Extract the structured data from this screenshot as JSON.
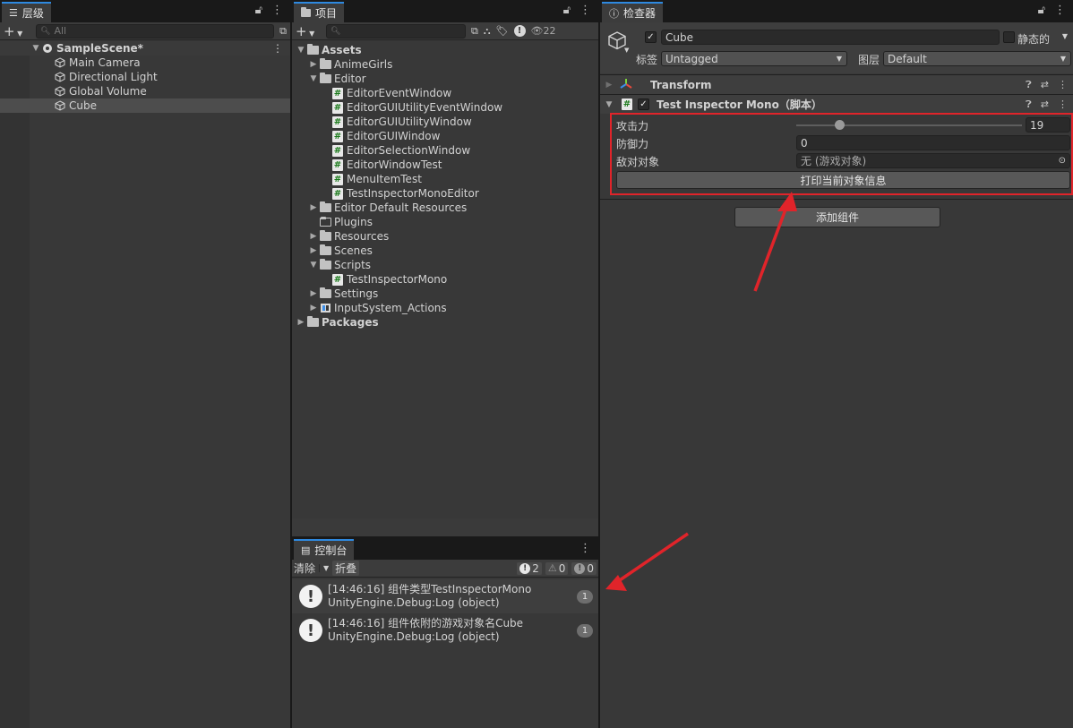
{
  "hierarchy": {
    "tab_label": "层级",
    "search_placeholder": "All",
    "scene": "SampleScene*",
    "items": [
      "Main Camera",
      "Directional Light",
      "Global Volume",
      "Cube"
    ],
    "selected": "Cube"
  },
  "project": {
    "tab_label": "项目",
    "hidden_count": "22",
    "tree": [
      {
        "label": "Assets",
        "depth": 0,
        "type": "folder-open",
        "expanded": true,
        "bold": true
      },
      {
        "label": "AnimeGirls",
        "depth": 1,
        "type": "folder",
        "expanded": false
      },
      {
        "label": "Editor",
        "depth": 1,
        "type": "folder-open",
        "expanded": true
      },
      {
        "label": "EditorEventWindow",
        "depth": 2,
        "type": "script"
      },
      {
        "label": "EditorGUIUtilityEventWindow",
        "depth": 2,
        "type": "script"
      },
      {
        "label": "EditorGUIUtilityWindow",
        "depth": 2,
        "type": "script"
      },
      {
        "label": "EditorGUIWindow",
        "depth": 2,
        "type": "script"
      },
      {
        "label": "EditorSelectionWindow",
        "depth": 2,
        "type": "script"
      },
      {
        "label": "EditorWindowTest",
        "depth": 2,
        "type": "script"
      },
      {
        "label": "MenuItemTest",
        "depth": 2,
        "type": "script"
      },
      {
        "label": "TestInspectorMonoEditor",
        "depth": 2,
        "type": "script"
      },
      {
        "label": "Editor Default Resources",
        "depth": 1,
        "type": "folder",
        "expanded": false
      },
      {
        "label": "Plugins",
        "depth": 1,
        "type": "folder-hollow"
      },
      {
        "label": "Resources",
        "depth": 1,
        "type": "folder",
        "expanded": false
      },
      {
        "label": "Scenes",
        "depth": 1,
        "type": "folder",
        "expanded": false
      },
      {
        "label": "Scripts",
        "depth": 1,
        "type": "folder-open",
        "expanded": true
      },
      {
        "label": "TestInspectorMono",
        "depth": 2,
        "type": "script"
      },
      {
        "label": "Settings",
        "depth": 1,
        "type": "folder",
        "expanded": false
      },
      {
        "label": "InputSystem_Actions",
        "depth": 1,
        "type": "input-actions",
        "expanded": false
      },
      {
        "label": "Packages",
        "depth": 0,
        "type": "folder",
        "expanded": false,
        "bold": true
      }
    ]
  },
  "console": {
    "tab_label": "控制台",
    "clear_label": "清除",
    "collapse_label": "折叠",
    "log_count": "2",
    "warn_count": "0",
    "error_count": "0",
    "entries": [
      {
        "line1": "[14:46:16] 组件类型TestInspectorMono",
        "line2": "UnityEngine.Debug:Log (object)",
        "count": "1"
      },
      {
        "line1": "[14:46:16] 组件依附的游戏对象名Cube",
        "line2": "UnityEngine.Debug:Log (object)",
        "count": "1"
      }
    ]
  },
  "inspector": {
    "tab_label": "检查器",
    "object_name": "Cube",
    "static_label": "静态的",
    "tag_label": "标签",
    "tag_value": "Untagged",
    "layer_label": "图层",
    "layer_value": "Default",
    "transform_label": "Transform",
    "component_label": "Test Inspector Mono（脚本）",
    "fields": {
      "attack_label": "攻击力",
      "attack_value": "19",
      "attack_fraction": 0.19,
      "defense_label": "防御力",
      "defense_value": "0",
      "enemy_label": "敌对对象",
      "enemy_value": "无 (游戏对象)"
    },
    "print_button": "打印当前对象信息",
    "add_component_button": "添加组件"
  },
  "colors": {
    "accent_tab": "#2e89e0",
    "highlight_red": "#e0242a",
    "panel_bg": "#383838"
  }
}
